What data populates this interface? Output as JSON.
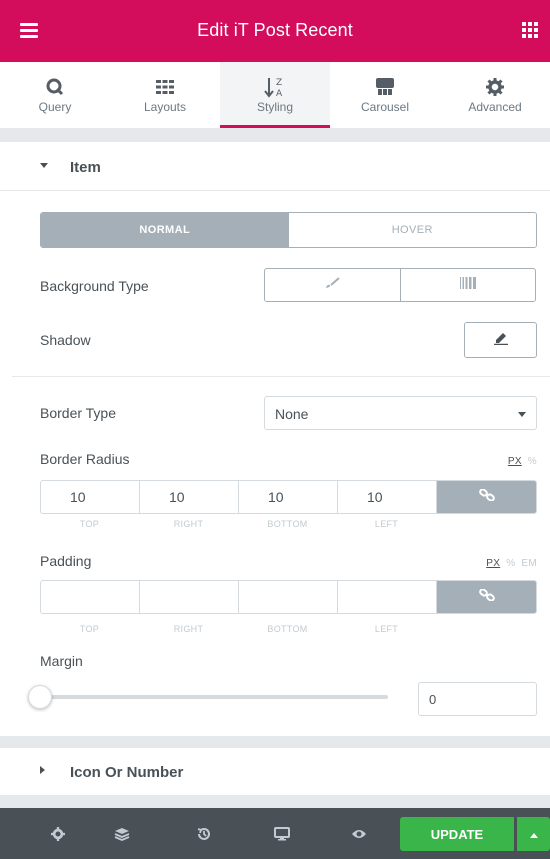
{
  "header": {
    "title": "Edit iT Post Recent",
    "menu_icon": "hamburger-icon",
    "apps_icon": "grid-icon"
  },
  "tabs": [
    {
      "label": "Query",
      "icon": "query-icon",
      "active": false
    },
    {
      "label": "Layouts",
      "icon": "layouts-icon",
      "active": false
    },
    {
      "label": "Styling",
      "icon": "sort-az-icon",
      "active": true
    },
    {
      "label": "Carousel",
      "icon": "carousel-icon",
      "active": false
    },
    {
      "label": "Advanced",
      "icon": "gear-icon",
      "active": false
    }
  ],
  "item_section": {
    "title": "Item",
    "state_toggle": {
      "normal": "NORMAL",
      "hover": "HOVER",
      "selected": "normal"
    },
    "background_type_label": "Background Type",
    "shadow_label": "Shadow",
    "border_type": {
      "label": "Border Type",
      "value": "None"
    },
    "border_radius": {
      "label": "Border Radius",
      "units": [
        "PX",
        "%"
      ],
      "selected_unit": "PX",
      "values": {
        "top": "10",
        "right": "10",
        "bottom": "10",
        "left": "10"
      },
      "sublabels": [
        "TOP",
        "RIGHT",
        "BOTTOM",
        "LEFT"
      ]
    },
    "padding": {
      "label": "Padding",
      "units": [
        "PX",
        "%",
        "EM"
      ],
      "selected_unit": "PX",
      "values": {
        "top": "",
        "right": "",
        "bottom": "",
        "left": ""
      },
      "sublabels": [
        "TOP",
        "RIGHT",
        "BOTTOM",
        "LEFT"
      ]
    },
    "margin": {
      "label": "Margin",
      "value": "0"
    }
  },
  "icon_section": {
    "title": "Icon Or Number"
  },
  "footer": {
    "update_label": "UPDATE"
  },
  "colors": {
    "brand": "#d30c5c",
    "update": "#39b54a",
    "footer_bg": "#495157",
    "toggle_active": "#a4afb7"
  }
}
